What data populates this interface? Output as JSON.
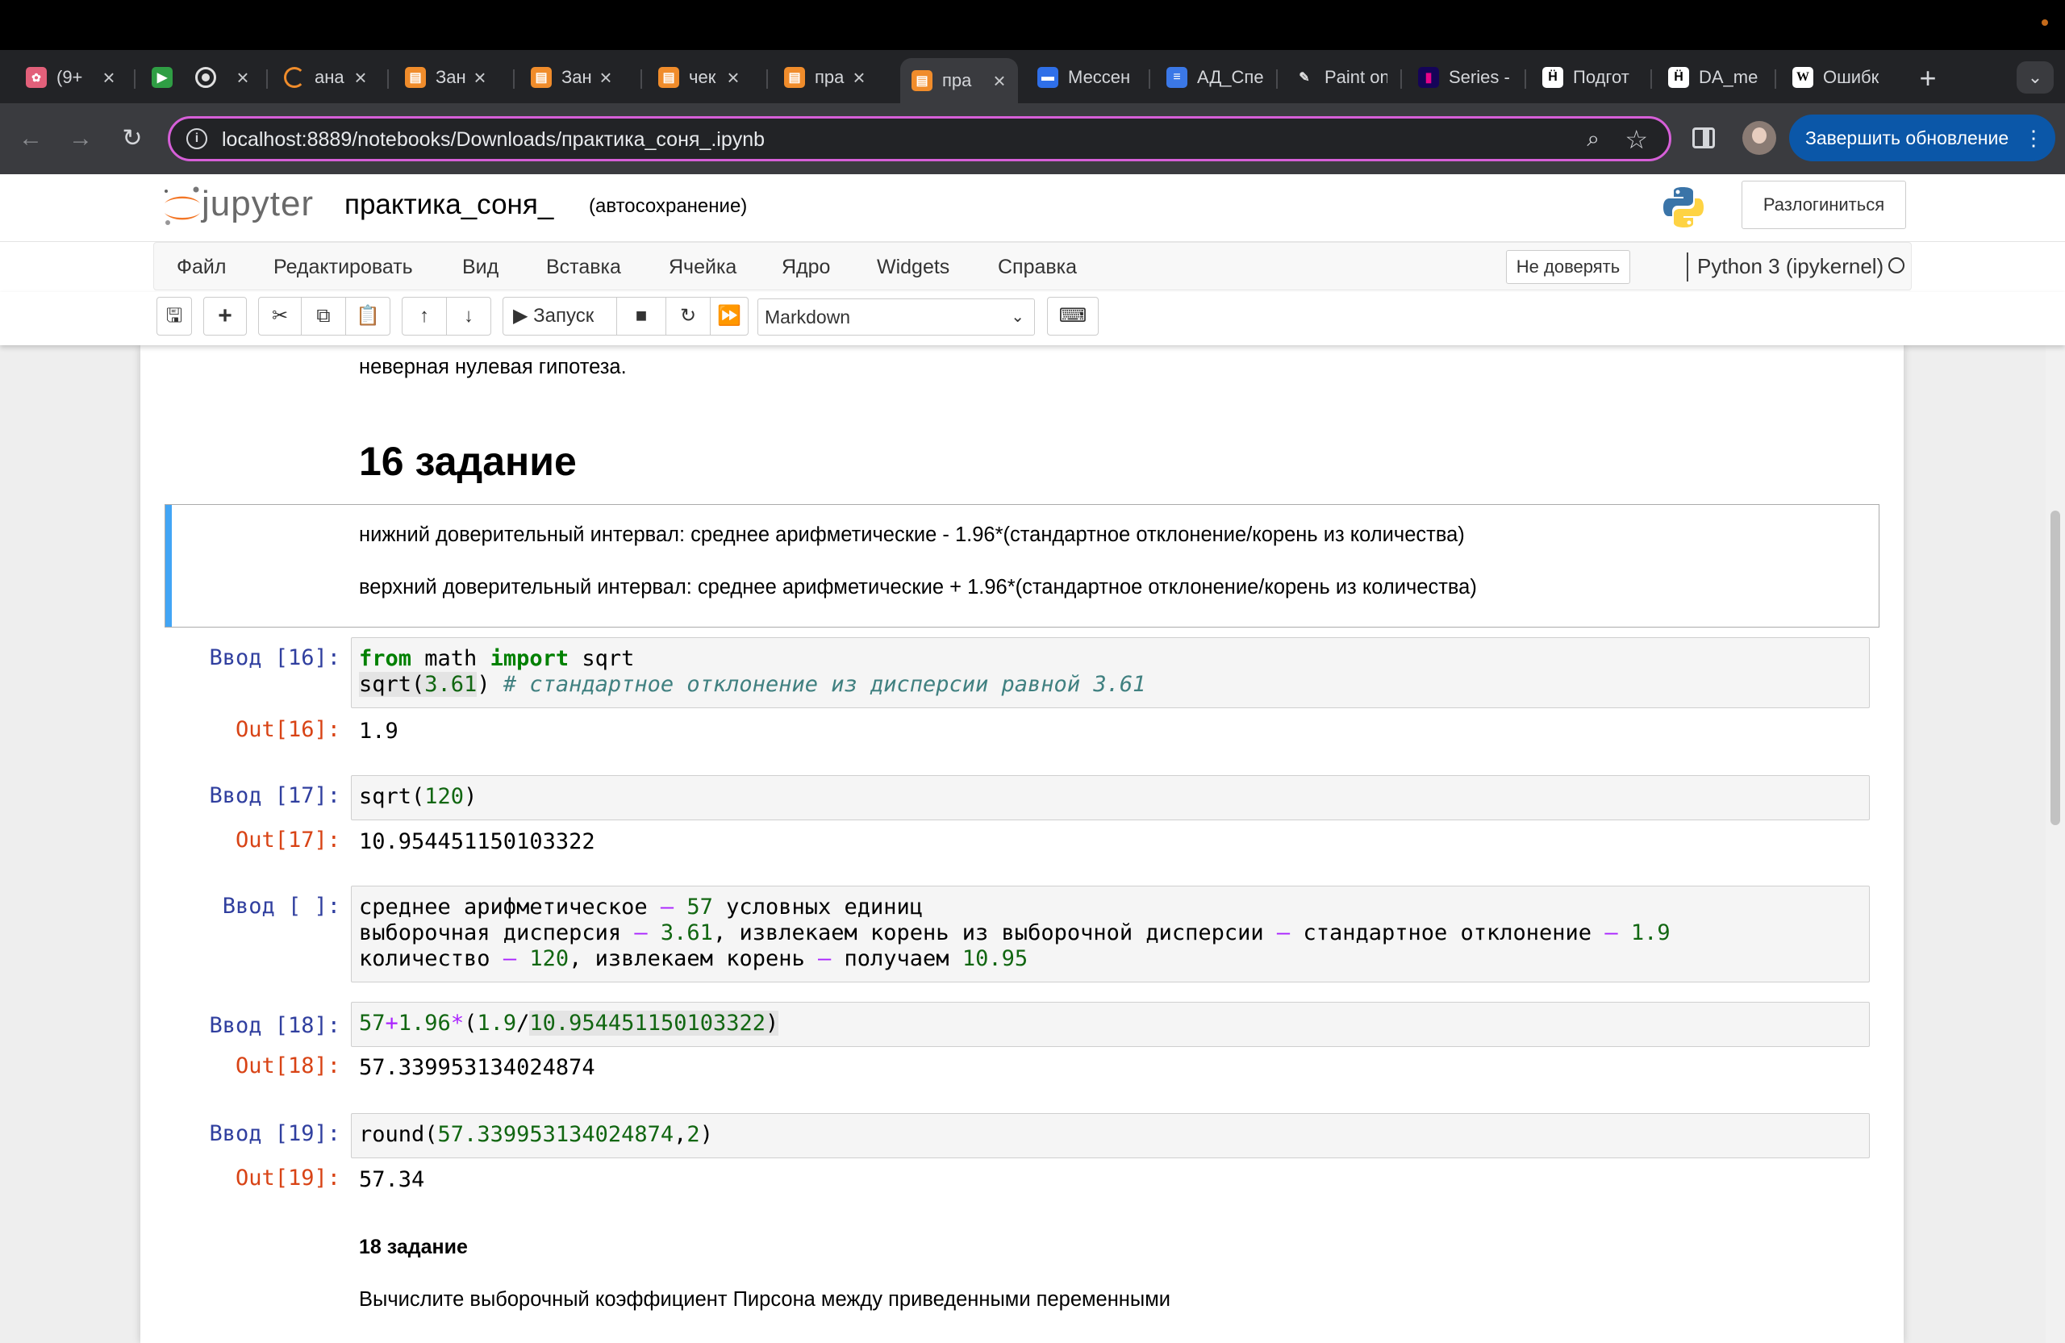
{
  "browser": {
    "tabs": [
      {
        "label": "(9+",
        "icon": "brain-icon",
        "color": "#e2607a"
      },
      {
        "label": "",
        "icon": "meet-icon",
        "color": "#2f9e44"
      },
      {
        "label": "",
        "icon": "record-icon",
        "color": "#e0e0e0"
      },
      {
        "label": "ана",
        "icon": "loading-icon",
        "color": "#f08c2b"
      },
      {
        "label": "Зан",
        "icon": "notebook-icon",
        "color": "#f08c2b"
      },
      {
        "label": "Зан",
        "icon": "notebook-icon",
        "color": "#f08c2b"
      },
      {
        "label": "чек",
        "icon": "notebook-icon",
        "color": "#f08c2b"
      },
      {
        "label": "пра",
        "icon": "notebook-icon",
        "color": "#f08c2b"
      },
      {
        "label": "пра",
        "icon": "notebook-icon",
        "color": "#f08c2b"
      },
      {
        "label": "Мессен",
        "icon": "chat-icon",
        "color": "#2f6fe8"
      },
      {
        "label": "АД_Спе",
        "icon": "docs-icon",
        "color": "#3b78e7"
      },
      {
        "label": "Paint on",
        "icon": "paintbrush-icon",
        "color": "#444"
      },
      {
        "label": "Series -",
        "icon": "pandas-icon",
        "color": "#150458"
      },
      {
        "label": "Подгот",
        "icon": "hse-icon",
        "color": "#ffffff"
      },
      {
        "label": "DA_me",
        "icon": "hse-icon",
        "color": "#ffffff"
      },
      {
        "label": "Ошибк",
        "icon": "wikipedia-icon",
        "color": "#ffffff"
      }
    ],
    "active_tab_index": 8,
    "new_tab": "+",
    "url": "localhost:8889/notebooks/Downloads/практика_соня_.ipynb",
    "update_button": "Завершить обновление"
  },
  "jupyter": {
    "logo_text": "jupyter",
    "notebook_name": "практика_соня_",
    "autosave": "(автосохранение)",
    "logout": "Разлогиниться",
    "menu": [
      "Файл",
      "Редактировать",
      "Вид",
      "Вставка",
      "Ячейка",
      "Ядро",
      "Widgets",
      "Справка"
    ],
    "trust": "Не доверять",
    "kernel": "Python 3 (ipykernel)",
    "toolbar": {
      "run": "Запуск",
      "cell_type": "Markdown"
    }
  },
  "notebook": {
    "partial_text": "неверная нулевая гипотеза.",
    "heading": "16 задание",
    "md_lines": [
      "нижний доверительный интервал: среднее арифметические - 1.96*(стандартное отклонение/корень из количества)",
      "верхний доверительный интервал: среднее арифметические + 1.96*(стандартное отклонение/корень из количества)"
    ],
    "cells": {
      "c16": {
        "prompt": "Ввод [16]:",
        "out_prompt": "Out[16]:",
        "line1": {
          "kw1": "from",
          "mod": " math ",
          "kw2": "import",
          "name": " sqrt"
        },
        "line2": {
          "fn": "sqrt(",
          "num": "3.61",
          "close": ")",
          "comment": " # стандартное отклонение из дисперсии равной 3.61"
        },
        "output": "1.9"
      },
      "c17": {
        "prompt": "Ввод [17]:",
        "out_prompt": "Out[17]:",
        "code": {
          "fn": "sqrt(",
          "num": "120",
          "close": ")"
        },
        "output": "10.954451150103322"
      },
      "cnote": {
        "prompt": "Ввод [ ]:",
        "l1": {
          "a": "среднее арифметическое ",
          "op": "–",
          "b": " ",
          "n": "57",
          "c": " условных единиц"
        },
        "l2": {
          "a": "выборочная дисперсия ",
          "op1": "–",
          "b": " ",
          "n1": "3.61",
          "c": ", извлекаем корень из выборочной дисперсии ",
          "op2": "–",
          "d": " стандартное отклонение ",
          "op3": "–",
          "e": " ",
          "n2": "1.9"
        },
        "l3": {
          "a": "количество ",
          "op1": "–",
          "b": " ",
          "n1": "120",
          "c": ", извлекаем корень ",
          "op2": "–",
          "d": " получаем ",
          "n2": "10.95"
        }
      },
      "c18": {
        "prompt": "Ввод [18]:",
        "out_prompt": "Out[18]:",
        "code": {
          "n1": "57",
          "op1": "+",
          "n2": "1.96",
          "op2": "*",
          "p": "(",
          "n3": "1.9",
          "op3": "/",
          "n4": "10.954451150103322",
          "close": ")"
        },
        "output": "57.339953134024874"
      },
      "c19": {
        "prompt": "Ввод [19]:",
        "out_prompt": "Out[19]:",
        "code": {
          "fn": "round(",
          "n1": "57.339953134024874",
          "comma": ",",
          "n2": "2",
          "close": ")"
        },
        "output": "57.34"
      }
    },
    "heading18": "18 задание",
    "task18": "Вычислите выборочный коэффициент Пирсона между приведенными переменными"
  }
}
